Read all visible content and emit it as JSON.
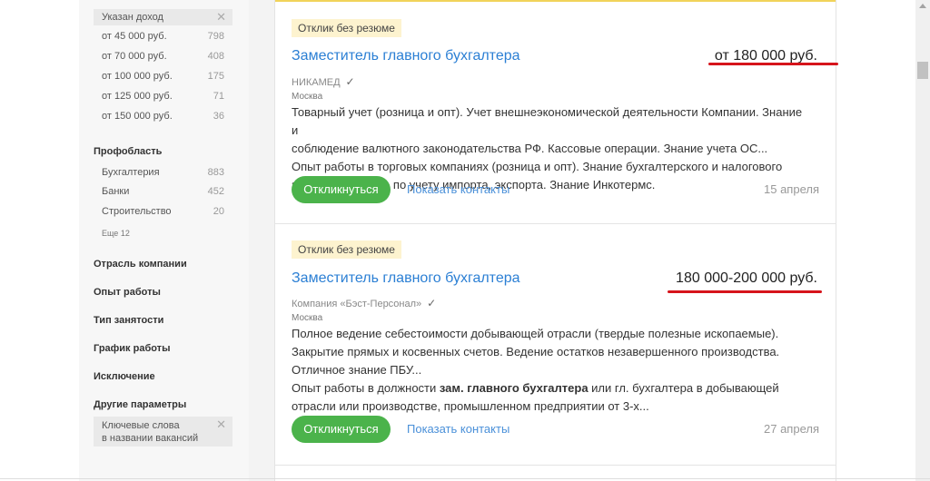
{
  "sidebar": {
    "income_chip": "Указан доход",
    "income_options": [
      {
        "label": "от 45 000 руб.",
        "count": "798"
      },
      {
        "label": "от 70 000 руб.",
        "count": "408"
      },
      {
        "label": "от 100 000 руб.",
        "count": "175"
      },
      {
        "label": "от 125 000 руб.",
        "count": "71"
      },
      {
        "label": "от 150 000 руб.",
        "count": "36"
      }
    ],
    "profarea_title": "Профобласть",
    "profarea_items": [
      {
        "label": "Бухгалтерия",
        "count": "883"
      },
      {
        "label": "Банки",
        "count": "452"
      },
      {
        "label": "Строительство",
        "count": "20"
      }
    ],
    "profarea_more": "Еще 12",
    "sections": [
      "Отрасль компании",
      "Опыт работы",
      "Тип занятости",
      "График работы",
      "Исключение",
      "Другие параметры"
    ],
    "keywords_chip_line1": "Ключевые слова",
    "keywords_chip_line2": "в названии вакансий"
  },
  "vacancies": [
    {
      "badge": "Отклик без резюме",
      "title": "Заместитель главного бухгалтера",
      "salary": "от 180 000 руб.",
      "company": "НИКАМЕД",
      "city": "Москва",
      "desc1": "Товарный учет (розница и опт). Учет внешнеэкономической деятельности Компании. Знание и",
      "desc2": "соблюдение валютного законодательства РФ. Кассовые операции. Знание учета ОС...",
      "desc3": "Опыт работы в торговых компаниях (розница и опт). Знание бухгалтерского и налогового",
      "desc4": "законодательства по учету импорта, экспорта. Знание Инкотермс.",
      "respond": "Откликнуться",
      "contacts": "Показать контакты",
      "date": "15 апреля"
    },
    {
      "badge": "Отклик без резюме",
      "title": "Заместитель главного бухгалтера",
      "salary": "180 000-200 000 руб.",
      "company": "Компания «Бэст-Персонал»",
      "city": "Москва",
      "desc1": "Полное ведение себестоимости добывающей отрасли (твердые полезные ископаемые).",
      "desc2": "Закрытие прямых и косвенных счетов. Ведение остатков незавершенного производства.",
      "desc3": "Отличное знание ПБУ...",
      "desc4_pre": "Опыт работы в должности ",
      "desc4_bold": "зам. главного бухгалтера",
      "desc4_post": " или гл. бухгалтера в добывающей",
      "desc5": "отрасли или производстве, промышленном предприятии от 3-х...",
      "respond": "Откликнуться",
      "contacts": "Показать контакты",
      "date": "27 апреля"
    }
  ],
  "colors": {
    "link": "#2b7fd4",
    "respond_button": "#4bb34b",
    "badge_bg": "#fdf3cf",
    "annotation_underline": "#d6141b"
  },
  "icons": [
    "close-icon",
    "verified-check-icon",
    "scroll-up-arrow-icon"
  ]
}
